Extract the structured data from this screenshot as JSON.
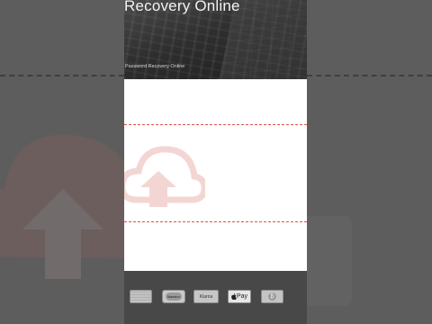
{
  "hero": {
    "title": "Recovery Online",
    "subtitle": "Password Recovery Online"
  },
  "payments": {
    "items": [
      {
        "name": "american-express",
        "label": ""
      },
      {
        "name": "maestro",
        "label": "Maestro"
      },
      {
        "name": "klarna",
        "label": "Klarna"
      },
      {
        "name": "apple-pay",
        "label": "Pay"
      },
      {
        "name": "bitcoin",
        "label": "₿"
      }
    ]
  },
  "colors": {
    "side_background": "#5d5d5d",
    "hero_background": "#2e2e2e",
    "footer_background": "#484848",
    "accent_dashes": "#d9534f",
    "cloud_tint": "#f3d6d3"
  },
  "icons": [
    "cloud-upload-icon",
    "apple-icon",
    "bitcoin-icon"
  ]
}
